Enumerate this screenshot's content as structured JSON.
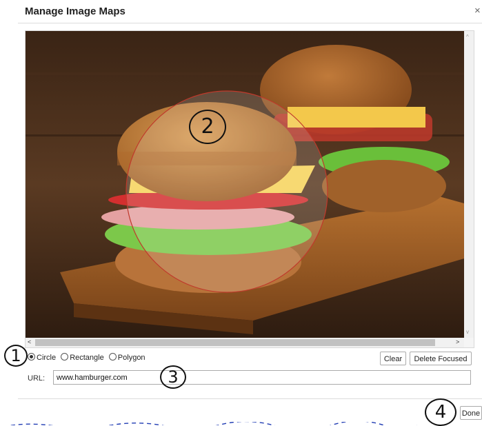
{
  "dialog": {
    "title": "Manage Image Maps",
    "close_glyph": "×"
  },
  "image": {
    "description_icon": "hamburger-photo"
  },
  "scrollbars": {
    "up_arrow": "^",
    "down_arrow": "v",
    "left_arrow": "<",
    "right_arrow": ">"
  },
  "shape_options": [
    {
      "label": "Circle",
      "selected": true
    },
    {
      "label": "Rectangle",
      "selected": false
    },
    {
      "label": "Polygon",
      "selected": false
    }
  ],
  "buttons": {
    "clear": "Clear",
    "delete_focused": "Delete Focused",
    "done": "Done"
  },
  "url": {
    "label": "URL:",
    "value": "www.hamburger.com"
  },
  "annotations": {
    "step1": "1",
    "step2": "2",
    "step3": "3",
    "step4": "4"
  },
  "colors": {
    "circle_outline": "#c0392b",
    "callout_ink": "#111111",
    "handwriting_ink": "#1f3bb3"
  }
}
